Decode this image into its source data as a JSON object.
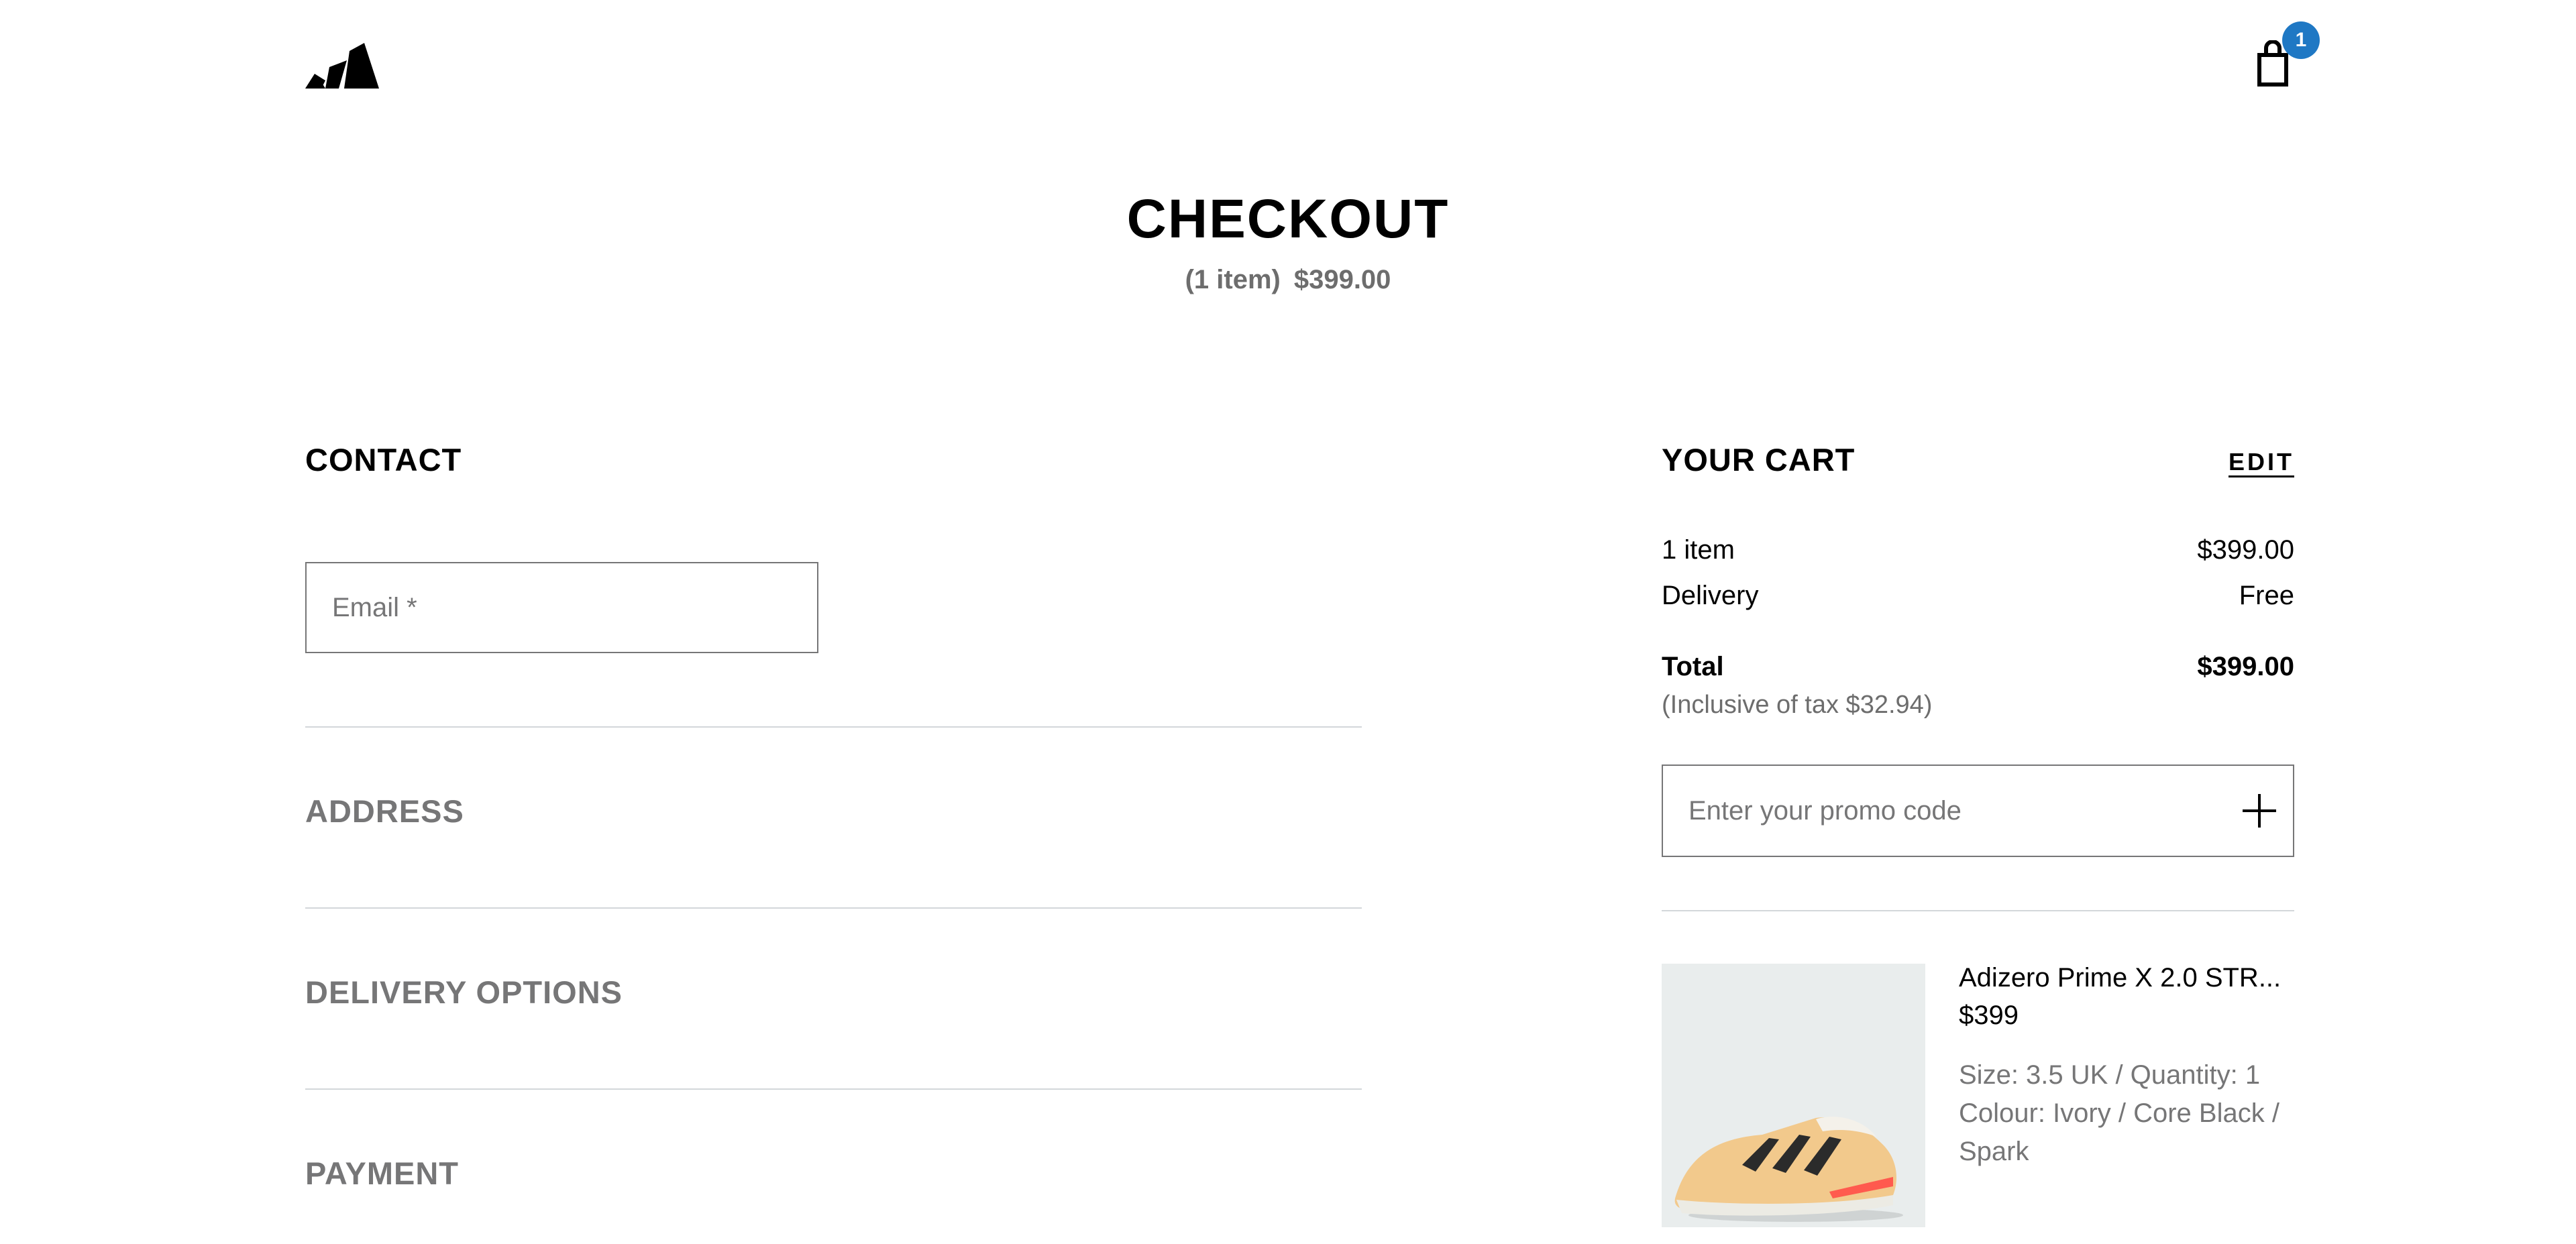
{
  "header": {
    "logo_icon": "adidas-logo",
    "cart_icon": "shopping-bag-icon",
    "cart_count": "1",
    "badge_color": "#1f78c4"
  },
  "title": {
    "heading": "CHECKOUT",
    "item_count": "(1 item)",
    "total": "$399.00"
  },
  "checkout": {
    "contact_heading": "CONTACT",
    "email_placeholder": "Email *",
    "address_heading": "ADDRESS",
    "delivery_heading": "DELIVERY OPTIONS",
    "payment_heading": "PAYMENT"
  },
  "cart": {
    "heading": "YOUR CART",
    "edit_label": "EDIT",
    "items_label": "1 item",
    "items_value": "$399.00",
    "delivery_label": "Delivery",
    "delivery_value": "Free",
    "total_label": "Total",
    "total_value": "$399.00",
    "tax_note": "(Inclusive of tax  $32.94)",
    "promo_placeholder": "Enter your promo code",
    "promo_icon": "plus-icon",
    "product": {
      "name": "Adizero Prime X 2.0 STR...",
      "price": "$399",
      "size_qty": "Size: 3.5 UK / Quantity: 1",
      "colour": "Colour: Ivory / Core Black / Spark",
      "image_icon": "sneaker-image"
    }
  },
  "colors": {
    "muted": "#767677",
    "divider": "#d3d7da",
    "image_bg": "#e9eded"
  }
}
